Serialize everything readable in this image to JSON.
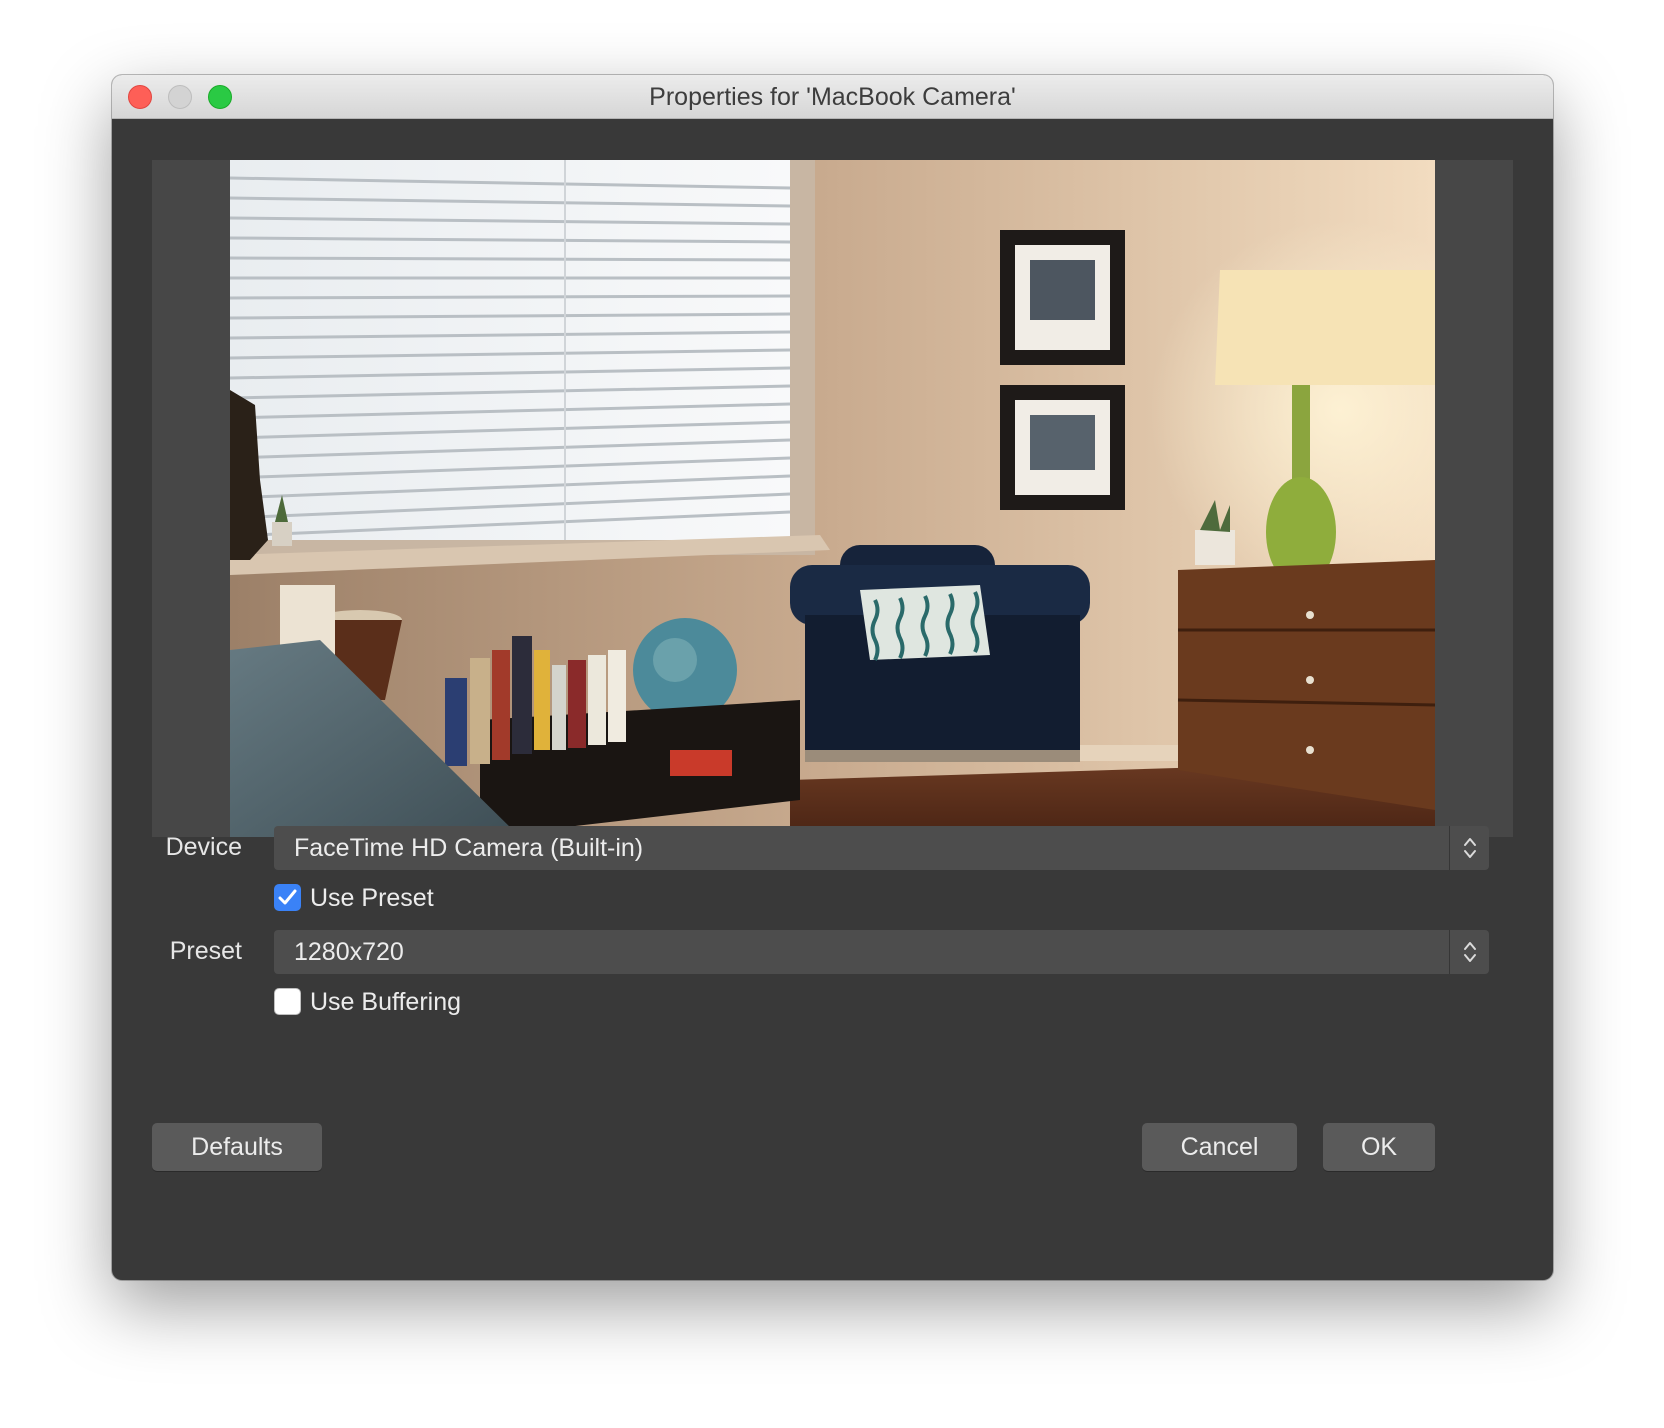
{
  "window": {
    "title": "Properties for 'MacBook Camera'"
  },
  "preview": {
    "description_icon": "camera-preview"
  },
  "device": {
    "label": "Device",
    "selected": "FaceTime HD Camera (Built-in)"
  },
  "use_preset": {
    "label": "Use Preset",
    "checked": true
  },
  "preset": {
    "label": "Preset",
    "selected": "1280x720"
  },
  "use_buffering": {
    "label": "Use Buffering",
    "checked": false
  },
  "buttons": {
    "defaults": "Defaults",
    "cancel": "Cancel",
    "ok": "OK"
  },
  "colors": {
    "window_bg": "#393939",
    "field_bg": "#4d4d4d",
    "button_bg": "#5a5a5a",
    "checkbox_accent": "#3a82f7",
    "close": "#fe5f57",
    "zoom": "#2aca44"
  }
}
